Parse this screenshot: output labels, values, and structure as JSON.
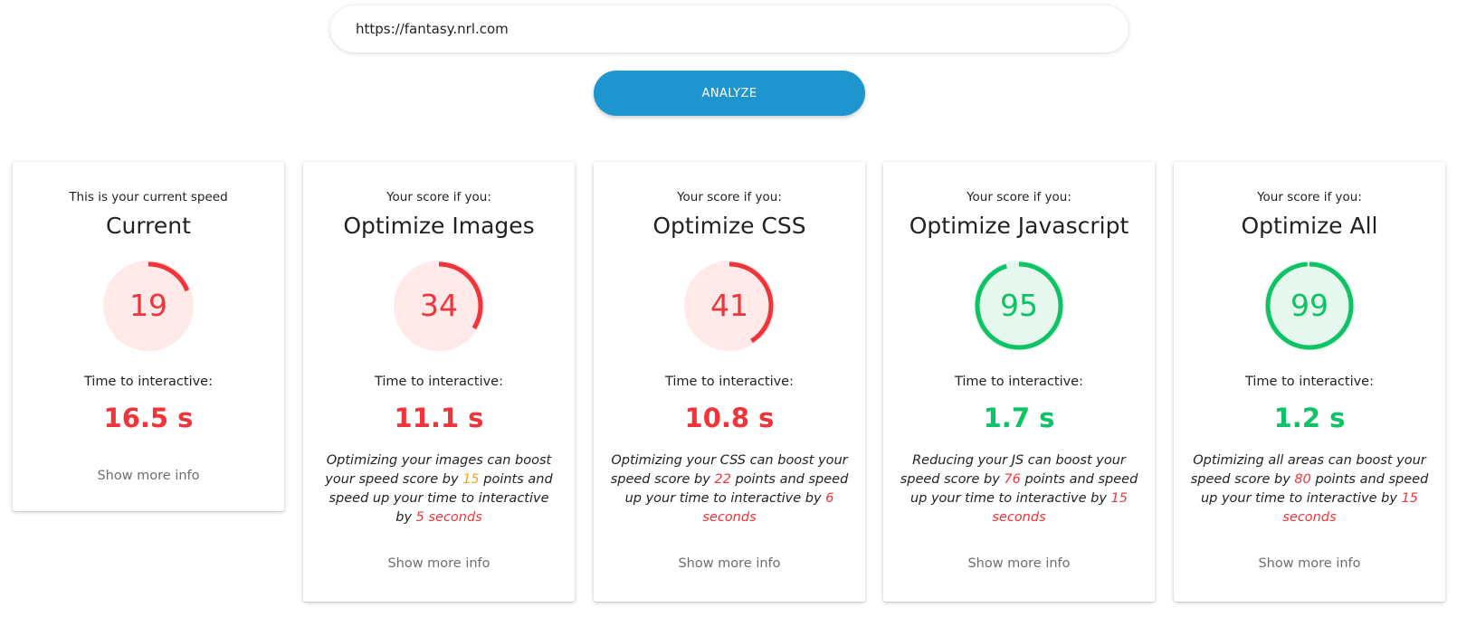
{
  "search": {
    "url_value": "https://fantasy.nrl.com"
  },
  "analyze_label": "ANALYZE",
  "colors": {
    "accent": "#1e95cf",
    "bad": "#f0343a",
    "good": "#0cc366",
    "warn": "#f1a41e"
  },
  "cards": [
    {
      "subtitle": "This is your current speed",
      "title": "Current",
      "score": "19",
      "score_fraction": 0.19,
      "status": "bad",
      "tti_label": "Time to interactive:",
      "tti_value": "16.5 s",
      "more": "Show more info"
    },
    {
      "subtitle": "Your score if you:",
      "title": "Optimize Images",
      "score": "34",
      "score_fraction": 0.34,
      "status": "bad",
      "tti_label": "Time to interactive:",
      "tti_value": "11.1 s",
      "desc_pre": "Optimizing your images can boost your speed score by ",
      "desc_points": "15",
      "points_status": "warn",
      "desc_mid": " points and speed up your time to interactive by ",
      "desc_time": "5 seconds",
      "more": "Show more info"
    },
    {
      "subtitle": "Your score if you:",
      "title": "Optimize CSS",
      "score": "41",
      "score_fraction": 0.41,
      "status": "bad",
      "tti_label": "Time to interactive:",
      "tti_value": "10.8 s",
      "desc_pre": "Optimizing your CSS can boost your speed score by ",
      "desc_points": "22",
      "points_status": "bad",
      "desc_mid": " points and speed up your time to interactive by ",
      "desc_time": "6 seconds",
      "more": "Show more info"
    },
    {
      "subtitle": "Your score if you:",
      "title": "Optimize Javascript",
      "score": "95",
      "score_fraction": 0.95,
      "status": "good",
      "tti_label": "Time to interactive:",
      "tti_value": "1.7 s",
      "desc_pre": "Reducing your JS can boost your speed score by ",
      "desc_points": "76",
      "points_status": "bad",
      "desc_mid": " points and speed up your time to interactive by ",
      "desc_time": "15 seconds",
      "more": "Show more info"
    },
    {
      "subtitle": "Your score if you:",
      "title": "Optimize All",
      "score": "99",
      "score_fraction": 0.99,
      "status": "good",
      "tti_label": "Time to interactive:",
      "tti_value": "1.2 s",
      "desc_pre": "Optimizing all areas can boost your speed score by ",
      "desc_points": "80",
      "points_status": "bad",
      "desc_mid": " points and speed up your time to interactive by ",
      "desc_time": "15 seconds",
      "more": "Show more info"
    }
  ]
}
